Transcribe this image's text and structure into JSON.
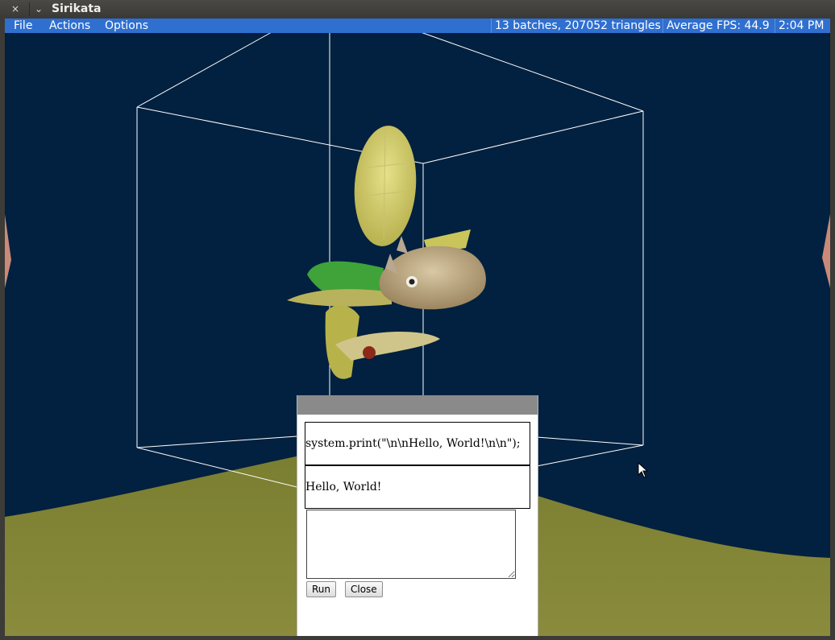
{
  "window": {
    "title": "Sirikata",
    "close_glyph": "×",
    "menu_glyph": "⌄"
  },
  "menubar": {
    "items": [
      "File",
      "Actions",
      "Options"
    ],
    "status": [
      "13 batches, 207052 triangles",
      "Average FPS: 44.9",
      "2:04 PM"
    ]
  },
  "console": {
    "code_line": "system.print(\"\\n\\nHello, World!\\n\\n\");",
    "output": "Hello, World!",
    "input_value": "",
    "run_label": "Run",
    "close_label": "Close"
  },
  "colors": {
    "sky": "#02203f",
    "ground": "#808432",
    "menubar": "#2f6fd0",
    "wireframe": "#ffffff"
  }
}
